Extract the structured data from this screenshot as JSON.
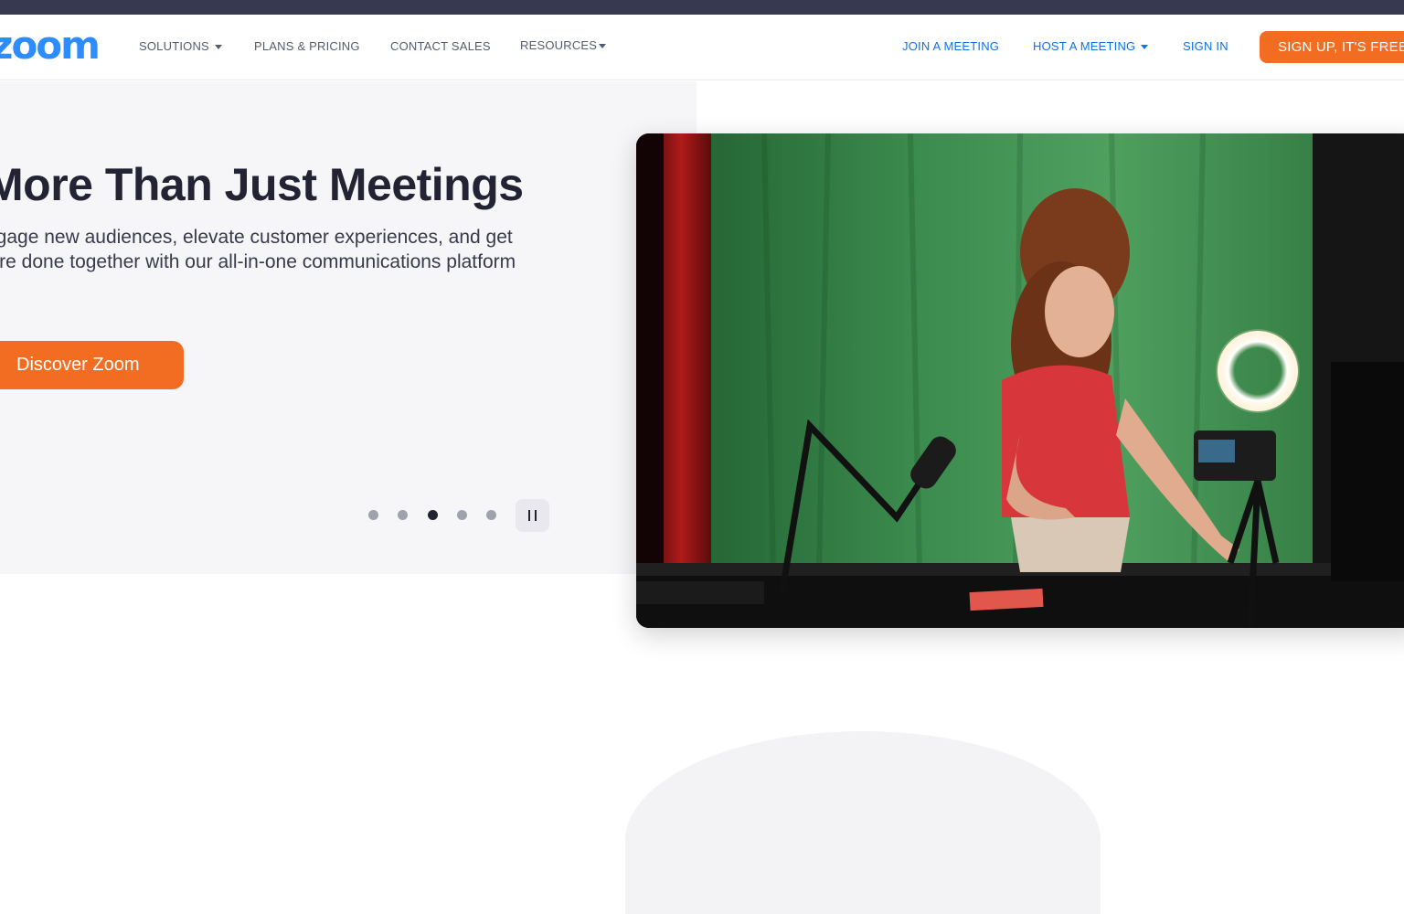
{
  "header": {
    "logo_text": "zoom",
    "nav_left": [
      {
        "label": "SOLUTIONS",
        "has_dropdown": true
      },
      {
        "label": "PLANS & PRICING",
        "has_dropdown": false
      },
      {
        "label": "CONTACT SALES",
        "has_dropdown": false
      },
      {
        "label": "RESOURCES",
        "has_dropdown": true
      }
    ],
    "nav_right": [
      {
        "label": "JOIN A MEETING",
        "has_dropdown": false
      },
      {
        "label": "HOST A MEETING",
        "has_dropdown": true
      },
      {
        "label": "SIGN IN",
        "has_dropdown": false
      }
    ],
    "signup_label": "SIGN UP, IT'S FREE"
  },
  "hero": {
    "title": "More Than Just Meetings",
    "description": "Engage new audiences, elevate customer experiences, and get more done together with our all-in-one communications platform",
    "cta_label": "Discover Zoom",
    "carousel": {
      "slide_count": 5,
      "active_index": 2,
      "pause_icon": "pause-icon"
    },
    "image_description": "woman presenting at desk with microphone and ring light in green screen studio"
  },
  "colors": {
    "brand_blue": "#2d8cff",
    "nav_blue": "#0e72ed",
    "cta_orange": "#f26d21",
    "topbar": "#363950",
    "text_dark": "#232333"
  }
}
